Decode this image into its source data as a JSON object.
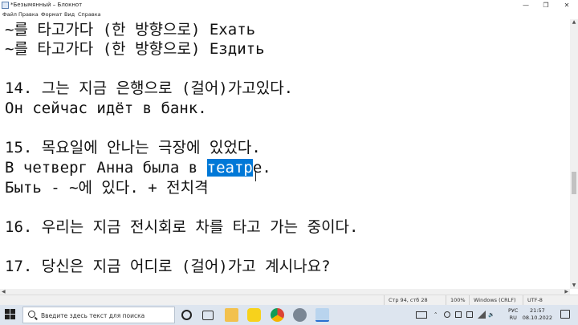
{
  "window": {
    "title": "*Безымянный – Блокнот",
    "min_glyph": "—",
    "max_glyph": "❐",
    "close_glyph": "✕"
  },
  "menu": [
    "Файл",
    "Правка",
    "Формат",
    "Вид",
    "Справка"
  ],
  "editor": {
    "lines": [
      "~를 타고가다 (한 방향으로) Ехать",
      "~를 타고가다 (한 방향으로) Ездить",
      "",
      "14. 그는 지금 은행으로 (걸어)가고있다.",
      "Он сейчас идёт в банк.",
      "",
      "15. 목요일에 안나는 극장에 있었다.",
      "",
      "Быть - ~에 있다. + 전치격",
      "",
      "16. 우리는 지금 전시회로 차를 타고 가는 중이다.",
      "",
      "17. 당신은 지금 어디로 (걸어)가고 계시나요?"
    ],
    "line_with_selection": {
      "before": "В четверг Анна была в ",
      "selected": "театр",
      "after": "е."
    }
  },
  "status": {
    "position": "Стр 94, стб 28",
    "zoom": "100%",
    "line_ending": "Windows (CRLF)",
    "encoding": "UTF-8"
  },
  "taskbar": {
    "search_placeholder": "Введите здесь текст для поиска",
    "lang_top": "РУС",
    "lang_bottom": "RU",
    "time": "21:57",
    "date": "08.10.2022"
  },
  "colors": {
    "selection": "#0078d7",
    "taskbar": "#dde5ef"
  }
}
